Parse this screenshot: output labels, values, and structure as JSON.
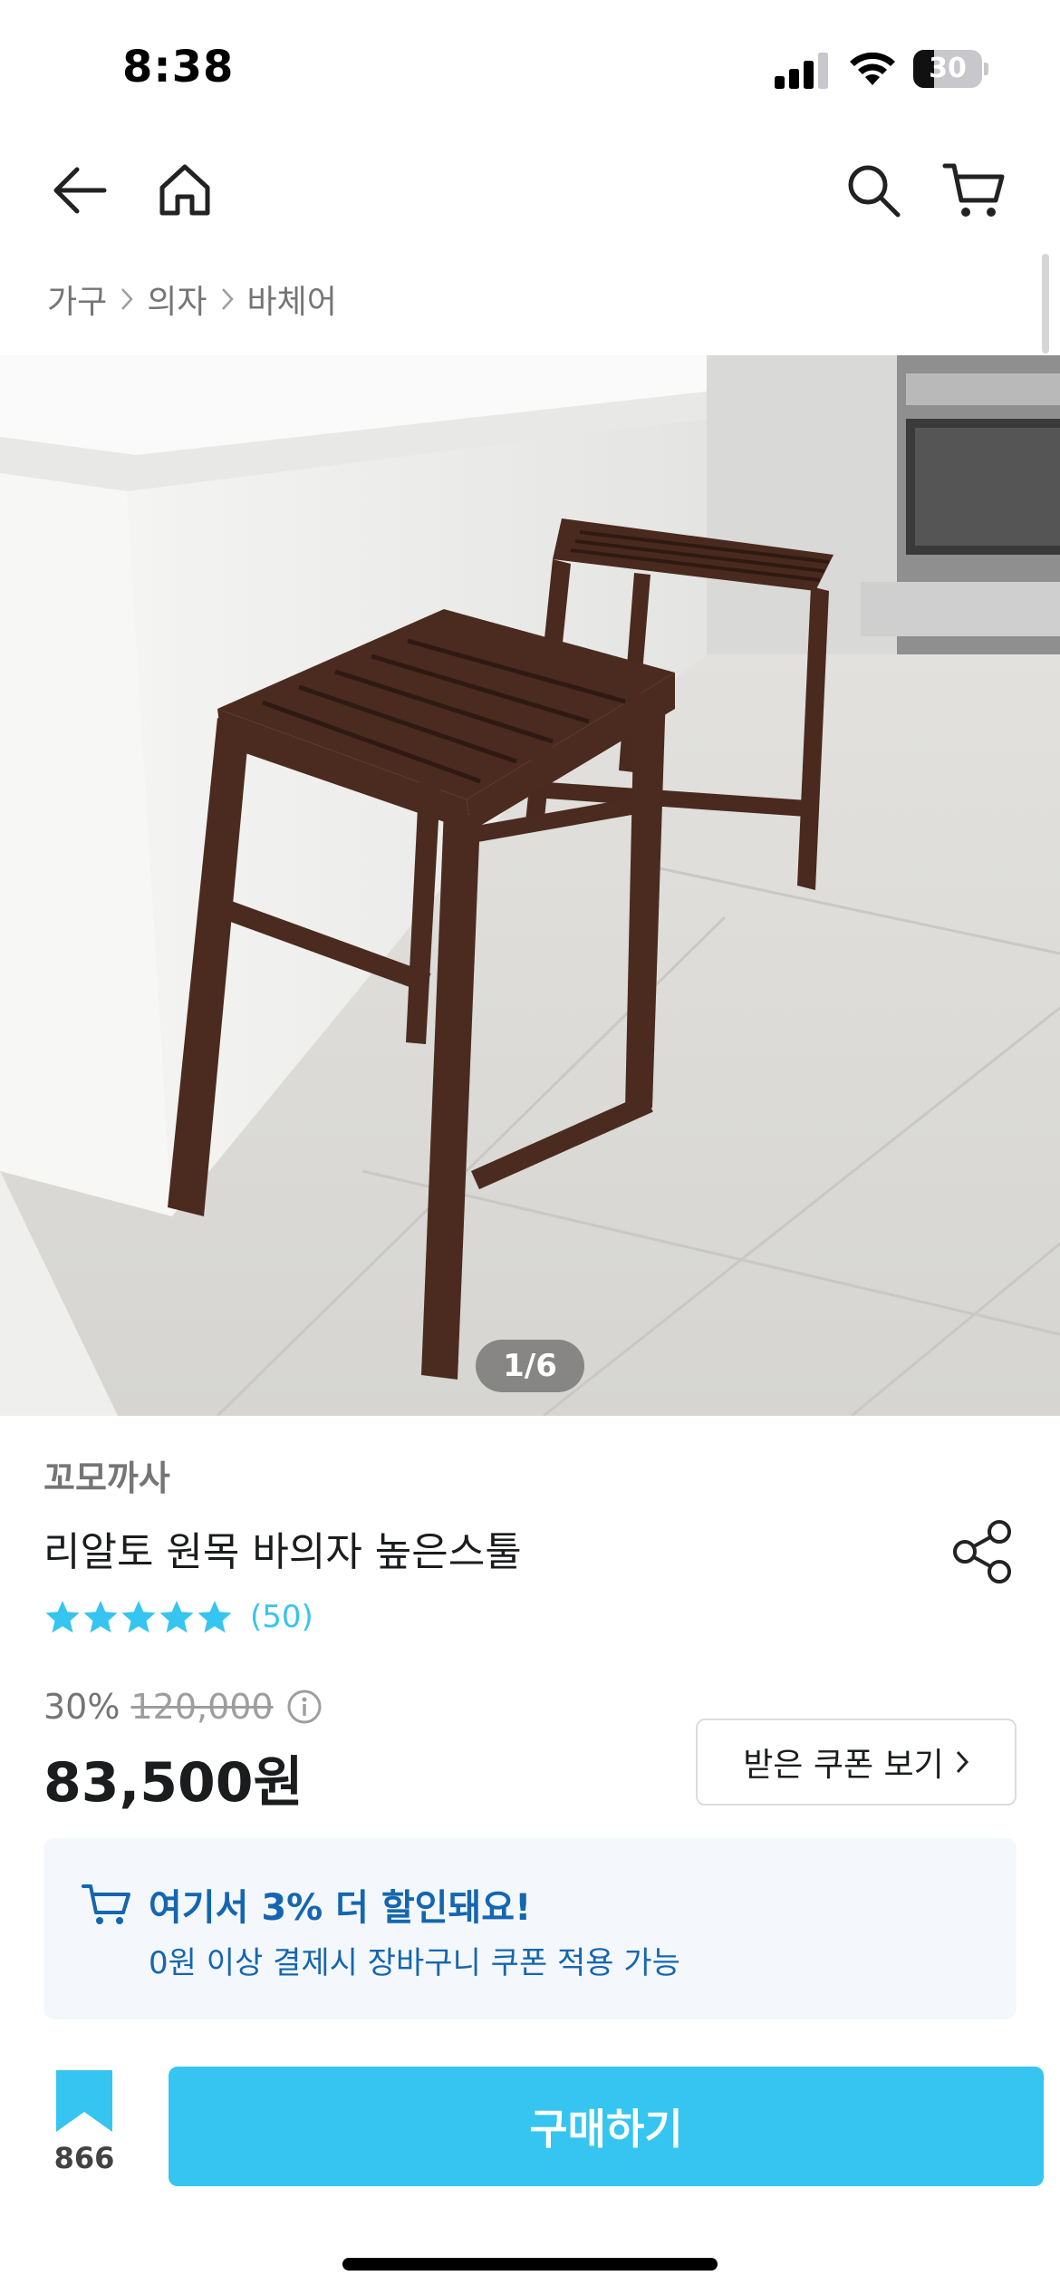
{
  "status_bar": {
    "time": "8:38",
    "battery_level": "30",
    "battery_fraction": 0.3
  },
  "nav": {
    "icons": [
      "back-arrow-icon",
      "home-icon",
      "search-icon",
      "cart-icon"
    ]
  },
  "breadcrumb": [
    "가구",
    "의자",
    "바체어"
  ],
  "gallery": {
    "page_indicator": "1/6"
  },
  "product": {
    "brand": "꼬모까사",
    "title": "리알토 원목 바의자 높은스툴",
    "rating_stars": 5,
    "review_count": "(50)",
    "discount_rate": "30%",
    "original_price": "120,000",
    "sale_price": "83,500원",
    "coupon_button_label": "받은 쿠폰 보기"
  },
  "extra_discount": {
    "headline": "여기서 3% 더 할인돼요!",
    "subtext": "0원 이상 결제시 장바구니 쿠폰 적용 가능"
  },
  "bottom_bar": {
    "bookmark_count": "866",
    "buy_label": "구매하기"
  },
  "colors": {
    "accent": "#35c5f0",
    "banner_text": "#1566b0",
    "banner_background": "#f4f8fc",
    "text_primary": "#1b1c1e",
    "text_secondary": "#757575"
  }
}
